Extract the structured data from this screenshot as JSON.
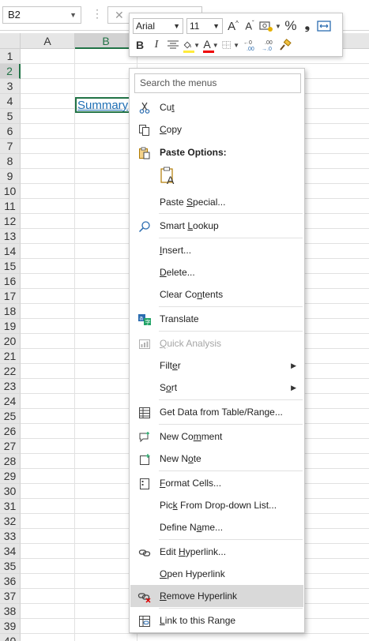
{
  "formula_bar": {
    "name_box": "B2",
    "fx_symbol": "✕"
  },
  "grid": {
    "columns": [
      "A",
      "B"
    ],
    "rows": [
      "1",
      "2",
      "3",
      "4",
      "5",
      "6",
      "7",
      "8",
      "9",
      "10",
      "11",
      "12",
      "13",
      "14",
      "15",
      "16",
      "17",
      "18",
      "19",
      "20",
      "21",
      "22",
      "23",
      "24",
      "25",
      "26",
      "27",
      "28",
      "29",
      "30",
      "31",
      "32",
      "33",
      "34",
      "35",
      "36",
      "37",
      "38",
      "39",
      "40"
    ],
    "selected_cell_text": "Summary"
  },
  "mini_toolbar": {
    "font_name": "Arial",
    "font_size": "11",
    "bold": "B",
    "italic": "I",
    "percent": "%",
    "comma": "❟",
    "highlight_color": "#ffeb3b",
    "font_color": "#e00000"
  },
  "menu": {
    "search_placeholder": "Search the menus",
    "cut": {
      "pre": "Cu",
      "u": "t",
      "post": ""
    },
    "copy": {
      "pre": "",
      "u": "C",
      "post": "opy"
    },
    "paste_options": "Paste Options:",
    "paste_special": {
      "pre": "Paste ",
      "u": "S",
      "post": "pecial..."
    },
    "smart_lookup": {
      "pre": "Smart ",
      "u": "L",
      "post": "ookup"
    },
    "insert": {
      "pre": "",
      "u": "I",
      "post": "nsert..."
    },
    "delete": {
      "pre": "",
      "u": "D",
      "post": "elete..."
    },
    "clear_contents": {
      "pre": "Clear Co",
      "u": "n",
      "post": "tents"
    },
    "translate": {
      "pre": "Translate",
      "u": "",
      "post": ""
    },
    "quick_analysis": {
      "pre": "",
      "u": "Q",
      "post": "uick Analysis"
    },
    "filter": {
      "pre": "Filt",
      "u": "e",
      "post": "r"
    },
    "sort": {
      "pre": "S",
      "u": "o",
      "post": "rt"
    },
    "get_data": {
      "pre": "Get Data from Table/Range",
      "u": "",
      "post": "..."
    },
    "new_comment": {
      "pre": "New Co",
      "u": "m",
      "post": "ment"
    },
    "new_note": {
      "pre": "New N",
      "u": "o",
      "post": "te"
    },
    "format_cells": {
      "pre": "",
      "u": "F",
      "post": "ormat Cells..."
    },
    "pick_dropdown": {
      "pre": "Pic",
      "u": "k",
      "post": " From Drop-down List..."
    },
    "define_name": {
      "pre": "Define N",
      "u": "a",
      "post": "me..."
    },
    "edit_hyperlink": {
      "pre": "Edit ",
      "u": "H",
      "post": "yperlink..."
    },
    "open_hyperlink": {
      "pre": "",
      "u": "O",
      "post": "pen Hyperlink"
    },
    "remove_hyperlink": {
      "pre": "",
      "u": "R",
      "post": "emove Hyperlink"
    },
    "link_range": {
      "pre": "",
      "u": "L",
      "post": "ink to this Range"
    }
  }
}
